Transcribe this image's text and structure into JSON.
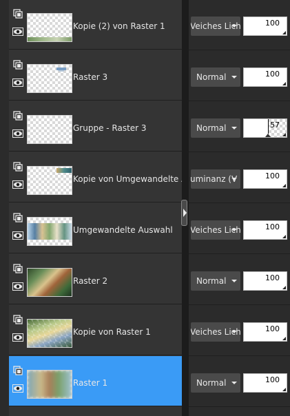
{
  "layers": [
    {
      "name": "Kopie (2) von Raster 1",
      "blend_mode": "Weiches Licht",
      "blend_display": "Veiches Lich",
      "opacity": 100,
      "selected": false,
      "thumb": "green-bottom-edge"
    },
    {
      "name": "Raster 3",
      "blend_mode": "Normal",
      "blend_display": "Normal",
      "opacity": 100,
      "selected": false,
      "thumb": "small-blue-mark"
    },
    {
      "name": "Gruppe - Raster 3",
      "blend_mode": "Normal",
      "blend_display": "Normal",
      "opacity": 57,
      "selected": false,
      "thumb": "transparent"
    },
    {
      "name": "Kopie von Umgewandelte Auswahl",
      "blend_mode": "Luminanz (Vorversion)",
      "blend_display": "uminanz (V",
      "opacity": 100,
      "selected": false,
      "thumb": "small-teal-corner"
    },
    {
      "name": "Umgewandelte Auswahl",
      "blend_mode": "Weiches Licht",
      "blend_display": "Veiches Lich",
      "opacity": 100,
      "selected": false,
      "thumb": "scene-strip"
    },
    {
      "name": "Raster 2",
      "blend_mode": "Normal",
      "blend_display": "Normal",
      "opacity": 100,
      "selected": false,
      "thumb": "garden-scene"
    },
    {
      "name": "Kopie von Raster 1",
      "blend_mode": "Weiches Licht",
      "blend_display": "Veiches Lich",
      "opacity": 100,
      "selected": false,
      "thumb": "mosaic-scene"
    },
    {
      "name": "Raster 1",
      "blend_mode": "Normal",
      "blend_display": "Normal",
      "opacity": 100,
      "selected": true,
      "thumb": "blurred-scene"
    }
  ],
  "icons": {
    "group": "layer-group-icon",
    "visibility": "eye-icon",
    "collapse": "collapse-arrow-icon",
    "dropdown": "chevron-down-icon"
  },
  "colors": {
    "panel_bg": "#343434",
    "selected_bg": "#3a9bf6",
    "divider": "#1c1c1c"
  }
}
